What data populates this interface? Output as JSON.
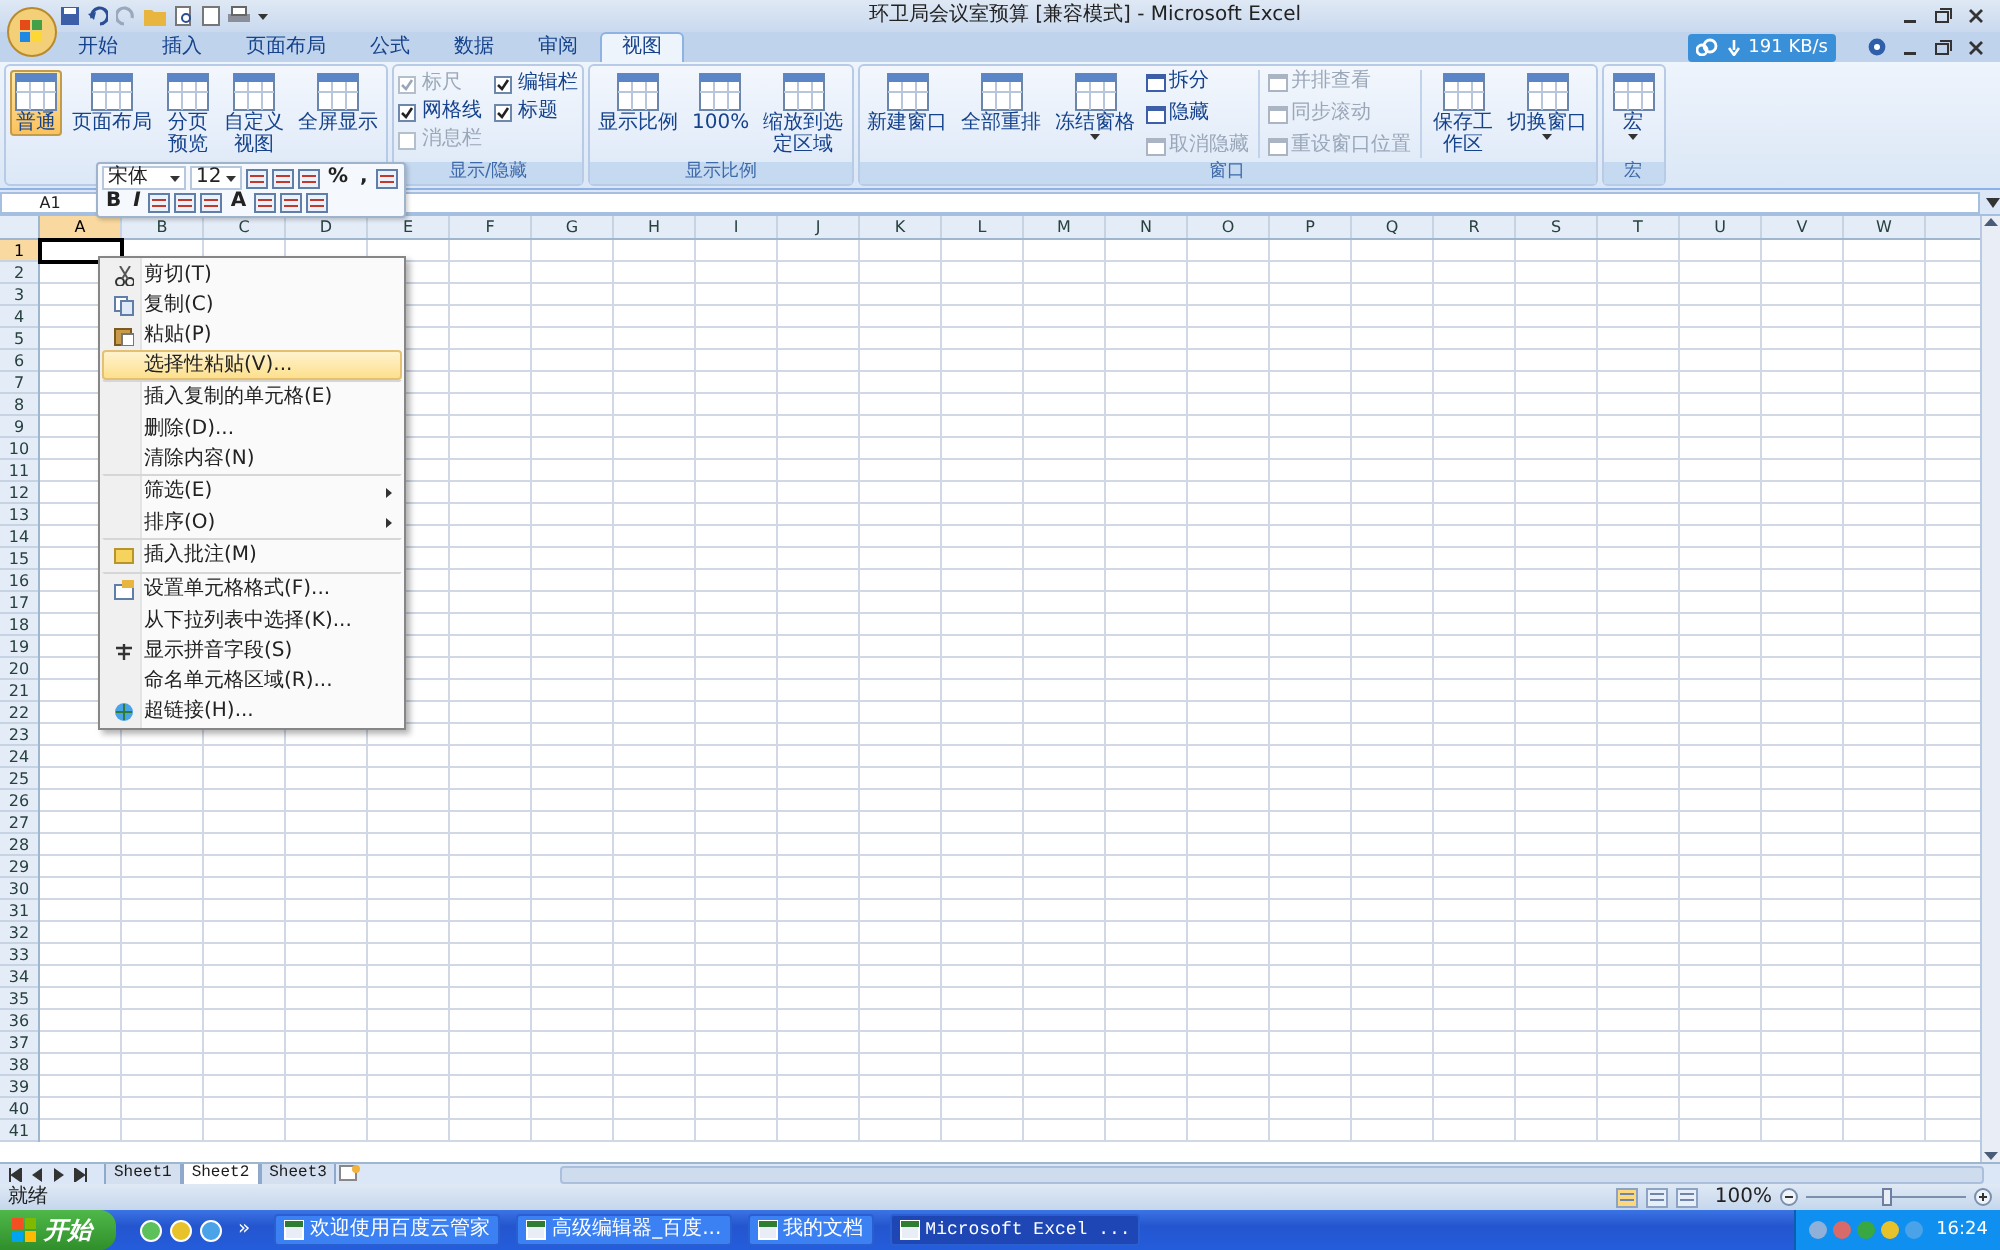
{
  "window": {
    "title": "环卫局会议室预算  [兼容模式] - Microsoft Excel"
  },
  "tabs": [
    {
      "label": "开始",
      "selected": false
    },
    {
      "label": "插入",
      "selected": false
    },
    {
      "label": "页面布局",
      "selected": false
    },
    {
      "label": "公式",
      "selected": false
    },
    {
      "label": "数据",
      "selected": false
    },
    {
      "label": "审阅",
      "selected": false
    },
    {
      "label": "视图",
      "selected": true
    }
  ],
  "download_speed": "191 KB/s",
  "ribbon_groups": [
    {
      "items": [
        {
          "kind": "large",
          "label": "普通",
          "selected": true,
          "wrap": false
        },
        {
          "kind": "large",
          "label": "页面布局",
          "selected": false,
          "wrap": false
        },
        {
          "kind": "large",
          "label": "分页预览",
          "selected": false,
          "wrap": true
        },
        {
          "kind": "large",
          "label": "自定义视图",
          "selected": false,
          "wrap": true
        },
        {
          "kind": "large",
          "label": "全屏显示",
          "selected": false,
          "wrap": false
        }
      ]
    },
    {
      "label": "显示/隐藏",
      "items": [
        {
          "kind": "check",
          "label": "标尺",
          "checked": true,
          "disabled": true
        },
        {
          "kind": "check",
          "label": "网格线",
          "checked": true,
          "disabled": false
        },
        {
          "kind": "check",
          "label": "消息栏",
          "checked": false,
          "disabled": true
        },
        {
          "kind": "check",
          "label": "编辑栏",
          "checked": true,
          "disabled": false
        },
        {
          "kind": "check",
          "label": "标题",
          "checked": true,
          "disabled": false
        }
      ]
    },
    {
      "label": "显示比例",
      "items": [
        {
          "kind": "large",
          "label": "显示比例",
          "wrap": false
        },
        {
          "kind": "large",
          "label": "100%",
          "wrap": false
        },
        {
          "kind": "large",
          "label": "缩放到选定区域",
          "wrap": true
        }
      ]
    },
    {
      "label": "窗口",
      "items": [
        {
          "kind": "large",
          "label": "新建窗口",
          "wrap": false,
          "dropdown": false
        },
        {
          "kind": "large",
          "label": "全部重排",
          "wrap": false,
          "dropdown": false
        },
        {
          "kind": "large",
          "label": "冻结窗格",
          "wrap": false,
          "dropdown": true
        },
        {
          "kind": "small",
          "label": "拆分",
          "disabled": false
        },
        {
          "kind": "small",
          "label": "隐藏",
          "disabled": false
        },
        {
          "kind": "small",
          "label": "取消隐藏",
          "disabled": true
        },
        {
          "kind": "small",
          "label": "并排查看",
          "disabled": true
        },
        {
          "kind": "small",
          "label": "同步滚动",
          "disabled": true
        },
        {
          "kind": "small",
          "label": "重设窗口位置",
          "disabled": true
        },
        {
          "kind": "large",
          "label": "保存工作区",
          "wrap": true,
          "dropdown": false
        },
        {
          "kind": "large",
          "label": "切换窗口",
          "wrap": false,
          "dropdown": true
        }
      ]
    },
    {
      "label": "宏",
      "items": [
        {
          "kind": "large",
          "label": "宏",
          "wrap": false,
          "dropdown": true
        }
      ]
    }
  ],
  "name_box": "A1",
  "columns": [
    {
      "label": "A",
      "selected": true
    },
    {
      "label": "B",
      "selected": false
    },
    {
      "label": "C",
      "selected": false
    },
    {
      "label": "D",
      "selected": false
    },
    {
      "label": "E",
      "selected": false
    },
    {
      "label": "F",
      "selected": false
    },
    {
      "label": "G",
      "selected": false
    },
    {
      "label": "H",
      "selected": false
    },
    {
      "label": "I",
      "selected": false
    },
    {
      "label": "J",
      "selected": false
    },
    {
      "label": "K",
      "selected": false
    },
    {
      "label": "L",
      "selected": false
    },
    {
      "label": "M",
      "selected": false
    },
    {
      "label": "N",
      "selected": false
    },
    {
      "label": "O",
      "selected": false
    },
    {
      "label": "P",
      "selected": false
    },
    {
      "label": "Q",
      "selected": false
    },
    {
      "label": "R",
      "selected": false
    },
    {
      "label": "S",
      "selected": false
    },
    {
      "label": "T",
      "selected": false
    },
    {
      "label": "U",
      "selected": false
    },
    {
      "label": "V",
      "selected": false
    },
    {
      "label": "W",
      "selected": false
    }
  ],
  "rows": [
    {
      "label": "1",
      "selected": true
    },
    {
      "label": "2",
      "selected": false
    },
    {
      "label": "3",
      "selected": false
    },
    {
      "label": "4",
      "selected": false
    },
    {
      "label": "5",
      "selected": false
    },
    {
      "label": "6",
      "selected": false
    },
    {
      "label": "7",
      "selected": false
    },
    {
      "label": "8",
      "selected": false
    },
    {
      "label": "9",
      "selected": false
    },
    {
      "label": "10",
      "selected": false
    },
    {
      "label": "11",
      "selected": false
    },
    {
      "label": "12",
      "selected": false
    },
    {
      "label": "13",
      "selected": false
    },
    {
      "label": "14",
      "selected": false
    },
    {
      "label": "15",
      "selected": false
    },
    {
      "label": "16",
      "selected": false
    },
    {
      "label": "17",
      "selected": false
    },
    {
      "label": "18",
      "selected": false
    },
    {
      "label": "19",
      "selected": false
    },
    {
      "label": "20",
      "selected": false
    },
    {
      "label": "21",
      "selected": false
    },
    {
      "label": "22",
      "selected": false
    },
    {
      "label": "23",
      "selected": false
    },
    {
      "label": "24",
      "selected": false
    },
    {
      "label": "25",
      "selected": false
    },
    {
      "label": "26",
      "selected": false
    },
    {
      "label": "27",
      "selected": false
    },
    {
      "label": "28",
      "selected": false
    },
    {
      "label": "29",
      "selected": false
    },
    {
      "label": "30",
      "selected": false
    },
    {
      "label": "31",
      "selected": false
    },
    {
      "label": "32",
      "selected": false
    },
    {
      "label": "33",
      "selected": false
    },
    {
      "label": "34",
      "selected": false
    },
    {
      "label": "35",
      "selected": false
    },
    {
      "label": "36",
      "selected": false
    },
    {
      "label": "37",
      "selected": false
    },
    {
      "label": "38",
      "selected": false
    },
    {
      "label": "39",
      "selected": false
    },
    {
      "label": "40",
      "selected": false
    },
    {
      "label": "41",
      "selected": false
    }
  ],
  "mini_toolbar": {
    "font": "宋体",
    "size": "12",
    "row_1": [
      {
        "kind": "icon"
      },
      {
        "kind": "icon"
      },
      {
        "kind": "icon"
      },
      {
        "kind": "text",
        "label": "%"
      },
      {
        "kind": "text",
        "label": ","
      },
      {
        "kind": "icon"
      }
    ],
    "row_2": [
      {
        "kind": "text",
        "label": "B"
      },
      {
        "kind": "text",
        "label": "I"
      },
      {
        "kind": "icon"
      },
      {
        "kind": "icon"
      },
      {
        "kind": "icon"
      },
      {
        "kind": "text",
        "label": "A"
      },
      {
        "kind": "icon"
      },
      {
        "kind": "icon"
      },
      {
        "kind": "icon"
      }
    ]
  },
  "context_menu": {
    "items": [
      {
        "kind": "cut",
        "label": "剪切(T)",
        "selected": false,
        "submenu": false,
        "separator_before": false
      },
      {
        "kind": "copy",
        "label": "复制(C)",
        "selected": false,
        "submenu": false,
        "separator_before": false
      },
      {
        "kind": "paste",
        "label": "粘贴(P)",
        "selected": false,
        "submenu": false,
        "separator_before": false
      },
      {
        "kind": "plain",
        "label": "选择性粘贴(V)...",
        "selected": true,
        "submenu": false,
        "separator_before": false
      },
      {
        "kind": "plain",
        "label": "插入复制的单元格(E)",
        "selected": false,
        "submenu": false,
        "separator_before": true
      },
      {
        "kind": "plain",
        "label": "删除(D)...",
        "selected": false,
        "submenu": false,
        "separator_before": false
      },
      {
        "kind": "plain",
        "label": "清除内容(N)",
        "selected": false,
        "submenu": false,
        "separator_before": false
      },
      {
        "kind": "plain",
        "label": "筛选(E)",
        "selected": false,
        "submenu": true,
        "separator_before": true
      },
      {
        "kind": "plain",
        "label": "排序(O)",
        "selected": false,
        "submenu": true,
        "separator_before": false
      },
      {
        "kind": "comment",
        "label": "插入批注(M)",
        "selected": false,
        "submenu": false,
        "separator_before": true
      },
      {
        "kind": "format",
        "label": "设置单元格格式(F)...",
        "selected": false,
        "submenu": false,
        "separator_before": true
      },
      {
        "kind": "plain",
        "label": "从下拉列表中选择(K)...",
        "selected": false,
        "submenu": false,
        "separator_before": false
      },
      {
        "kind": "phonetic",
        "label": "显示拼音字段(S)",
        "selected": false,
        "submenu": false,
        "separator_before": false
      },
      {
        "kind": "plain",
        "label": "命名单元格区域(R)...",
        "selected": false,
        "submenu": false,
        "separator_before": false
      },
      {
        "kind": "link",
        "label": "超链接(H)...",
        "selected": false,
        "submenu": false,
        "separator_before": false
      }
    ]
  },
  "sheet_tabs": [
    {
      "label": "Sheet1",
      "selected": false
    },
    {
      "label": "Sheet2",
      "selected": true
    },
    {
      "label": "Sheet3",
      "selected": false
    }
  ],
  "status_bar": {
    "text": "就绪",
    "zoom": "100%",
    "zoom_slider": {
      "level": 0.5
    }
  },
  "taskbar": {
    "start": "开始",
    "more": "»",
    "tasks": [
      {
        "label": "欢迎使用百度云管家",
        "selected": false
      },
      {
        "label": "高级编辑器_百度...",
        "selected": false
      },
      {
        "label": "我的文档",
        "selected": false
      },
      {
        "label": "Microsoft Excel ...",
        "selected": true
      }
    ],
    "clock": "16:24"
  }
}
